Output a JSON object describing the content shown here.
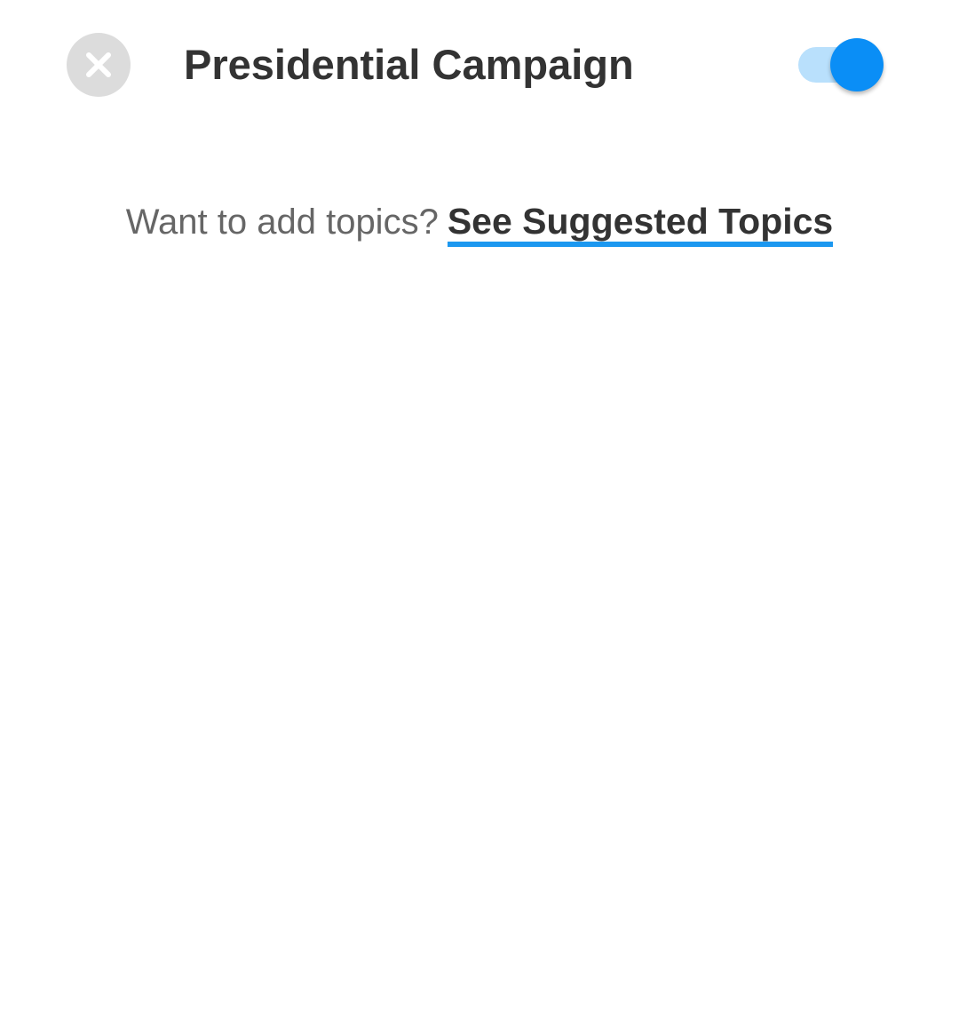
{
  "header": {
    "close_icon": "close-icon",
    "title": "Presidential Campaign",
    "follow_toggle": {
      "on": true,
      "track_color": "#b9e0fc",
      "thumb_color": "#0a8ef6"
    }
  },
  "suggestions": {
    "prompt": "Want to add topics?",
    "link_label": "See Suggested Topics",
    "link_underline_color": "#1c98f0"
  }
}
